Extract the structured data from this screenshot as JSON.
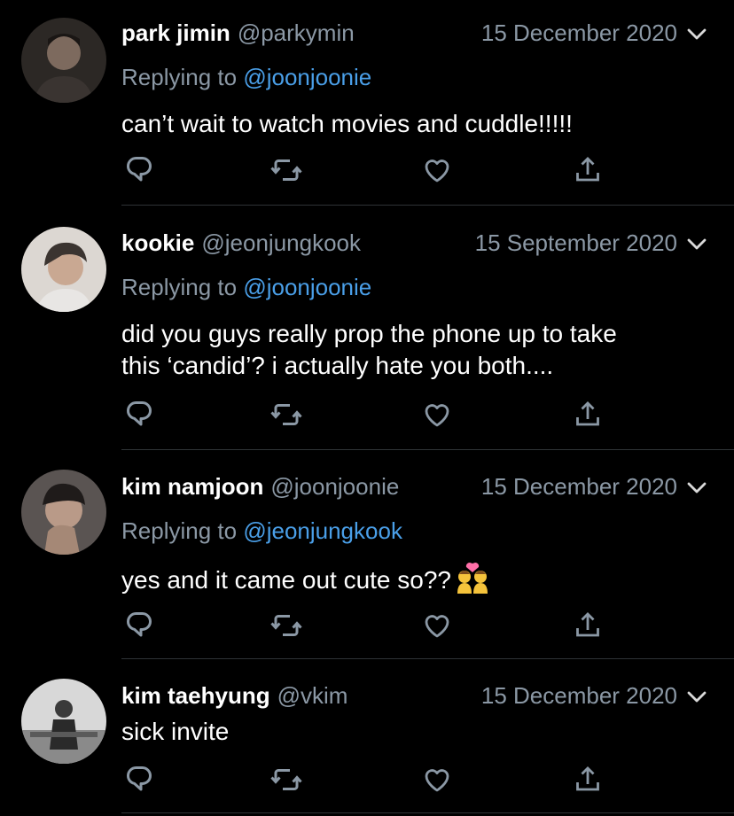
{
  "tweets": [
    {
      "name": "park jimin",
      "handle": "@parkymin",
      "date": "15 December 2020",
      "replying_prefix": "Replying to",
      "replying_to": "@joonjoonie",
      "text": "can’t wait to watch movies and cuddle!!!!!"
    },
    {
      "name": "kookie",
      "handle": "@jeonjungkook",
      "date": "15 September 2020",
      "replying_prefix": "Replying to",
      "replying_to": "@joonjoonie",
      "text_line1": "did you guys really prop the phone up to take",
      "text_line2": "this ‘candid’? i actually hate you both...."
    },
    {
      "name": "kim namjoon",
      "handle": "@joonjoonie",
      "date": "15 December 2020",
      "replying_prefix": "Replying to",
      "replying_to": "@jeonjungkook",
      "text": "yes and it came out cute so??",
      "emoji": "couple-with-heart-emoji"
    },
    {
      "name": "kim taehyung",
      "handle": "@vkim",
      "date": "15 December 2020",
      "text": "sick invite"
    }
  ],
  "icons": [
    "reply-icon",
    "retweet-icon",
    "like-icon",
    "share-icon",
    "chevron-down-icon"
  ],
  "colors": {
    "background": "#000000",
    "secondary_text": "#8b98a5",
    "mention": "#4a9fe8",
    "divider": "#2f3336",
    "icon": "#8b98a5"
  }
}
